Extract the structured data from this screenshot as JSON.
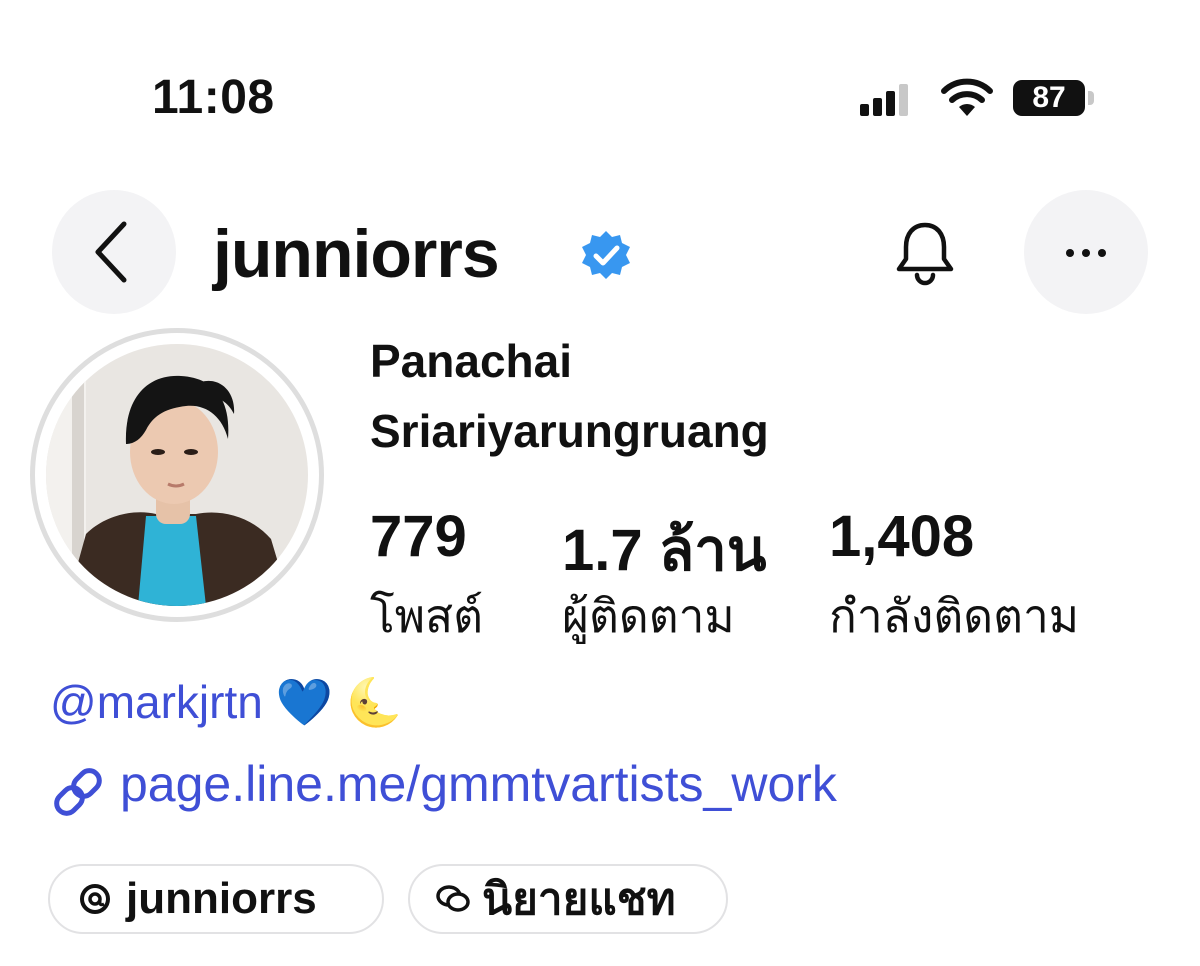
{
  "status_bar": {
    "time": "11:08",
    "battery": "87",
    "icons": [
      "signal-icon",
      "wifi-icon",
      "battery-icon"
    ]
  },
  "header": {
    "username": "junniorrs",
    "verified": true,
    "icons": [
      "back-arrow-icon",
      "verified-badge-icon",
      "bell-icon",
      "more-icon"
    ],
    "accent_color": "#3897f0"
  },
  "profile": {
    "name_line1": "Panachai",
    "name_line2": "Sriariyarungruang",
    "stats": [
      {
        "value": "779",
        "label": "โพสต์"
      },
      {
        "value": "1.7 ล้าน",
        "label": "ผู้ติดตาม"
      },
      {
        "value": "1,408",
        "label": "กำลังติดตาม"
      }
    ]
  },
  "bio": {
    "mention": "@markjrtn 💙 🌜",
    "link": "page.line.me/gmmtvartists_work",
    "link_color": "#3f4fd6"
  },
  "chips": [
    {
      "label": "junniorrs",
      "icon": "threads-icon"
    },
    {
      "label": "นิยายแชท",
      "icon": "chat-bubbles-icon"
    }
  ]
}
